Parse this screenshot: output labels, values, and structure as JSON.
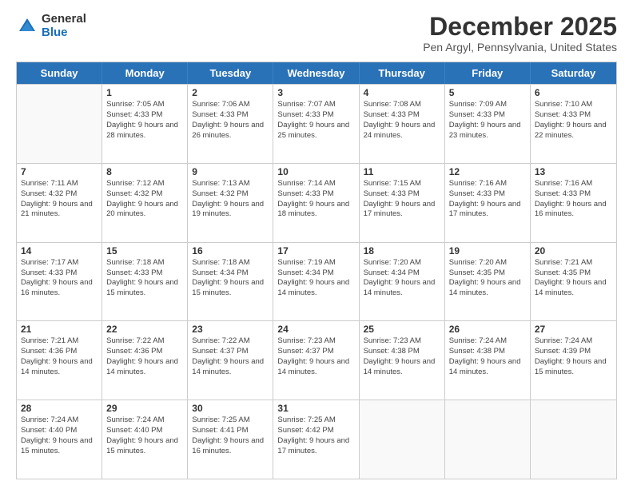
{
  "logo": {
    "general": "General",
    "blue": "Blue"
  },
  "header": {
    "month": "December 2025",
    "location": "Pen Argyl, Pennsylvania, United States"
  },
  "days": [
    "Sunday",
    "Monday",
    "Tuesday",
    "Wednesday",
    "Thursday",
    "Friday",
    "Saturday"
  ],
  "weeks": [
    [
      {
        "day": "",
        "empty": true
      },
      {
        "day": "1",
        "sunrise": "Sunrise: 7:05 AM",
        "sunset": "Sunset: 4:33 PM",
        "daylight": "Daylight: 9 hours and 28 minutes."
      },
      {
        "day": "2",
        "sunrise": "Sunrise: 7:06 AM",
        "sunset": "Sunset: 4:33 PM",
        "daylight": "Daylight: 9 hours and 26 minutes."
      },
      {
        "day": "3",
        "sunrise": "Sunrise: 7:07 AM",
        "sunset": "Sunset: 4:33 PM",
        "daylight": "Daylight: 9 hours and 25 minutes."
      },
      {
        "day": "4",
        "sunrise": "Sunrise: 7:08 AM",
        "sunset": "Sunset: 4:33 PM",
        "daylight": "Daylight: 9 hours and 24 minutes."
      },
      {
        "day": "5",
        "sunrise": "Sunrise: 7:09 AM",
        "sunset": "Sunset: 4:33 PM",
        "daylight": "Daylight: 9 hours and 23 minutes."
      },
      {
        "day": "6",
        "sunrise": "Sunrise: 7:10 AM",
        "sunset": "Sunset: 4:33 PM",
        "daylight": "Daylight: 9 hours and 22 minutes."
      }
    ],
    [
      {
        "day": "7",
        "sunrise": "Sunrise: 7:11 AM",
        "sunset": "Sunset: 4:32 PM",
        "daylight": "Daylight: 9 hours and 21 minutes."
      },
      {
        "day": "8",
        "sunrise": "Sunrise: 7:12 AM",
        "sunset": "Sunset: 4:32 PM",
        "daylight": "Daylight: 9 hours and 20 minutes."
      },
      {
        "day": "9",
        "sunrise": "Sunrise: 7:13 AM",
        "sunset": "Sunset: 4:32 PM",
        "daylight": "Daylight: 9 hours and 19 minutes."
      },
      {
        "day": "10",
        "sunrise": "Sunrise: 7:14 AM",
        "sunset": "Sunset: 4:33 PM",
        "daylight": "Daylight: 9 hours and 18 minutes."
      },
      {
        "day": "11",
        "sunrise": "Sunrise: 7:15 AM",
        "sunset": "Sunset: 4:33 PM",
        "daylight": "Daylight: 9 hours and 17 minutes."
      },
      {
        "day": "12",
        "sunrise": "Sunrise: 7:16 AM",
        "sunset": "Sunset: 4:33 PM",
        "daylight": "Daylight: 9 hours and 17 minutes."
      },
      {
        "day": "13",
        "sunrise": "Sunrise: 7:16 AM",
        "sunset": "Sunset: 4:33 PM",
        "daylight": "Daylight: 9 hours and 16 minutes."
      }
    ],
    [
      {
        "day": "14",
        "sunrise": "Sunrise: 7:17 AM",
        "sunset": "Sunset: 4:33 PM",
        "daylight": "Daylight: 9 hours and 16 minutes."
      },
      {
        "day": "15",
        "sunrise": "Sunrise: 7:18 AM",
        "sunset": "Sunset: 4:33 PM",
        "daylight": "Daylight: 9 hours and 15 minutes."
      },
      {
        "day": "16",
        "sunrise": "Sunrise: 7:18 AM",
        "sunset": "Sunset: 4:34 PM",
        "daylight": "Daylight: 9 hours and 15 minutes."
      },
      {
        "day": "17",
        "sunrise": "Sunrise: 7:19 AM",
        "sunset": "Sunset: 4:34 PM",
        "daylight": "Daylight: 9 hours and 14 minutes."
      },
      {
        "day": "18",
        "sunrise": "Sunrise: 7:20 AM",
        "sunset": "Sunset: 4:34 PM",
        "daylight": "Daylight: 9 hours and 14 minutes."
      },
      {
        "day": "19",
        "sunrise": "Sunrise: 7:20 AM",
        "sunset": "Sunset: 4:35 PM",
        "daylight": "Daylight: 9 hours and 14 minutes."
      },
      {
        "day": "20",
        "sunrise": "Sunrise: 7:21 AM",
        "sunset": "Sunset: 4:35 PM",
        "daylight": "Daylight: 9 hours and 14 minutes."
      }
    ],
    [
      {
        "day": "21",
        "sunrise": "Sunrise: 7:21 AM",
        "sunset": "Sunset: 4:36 PM",
        "daylight": "Daylight: 9 hours and 14 minutes."
      },
      {
        "day": "22",
        "sunrise": "Sunrise: 7:22 AM",
        "sunset": "Sunset: 4:36 PM",
        "daylight": "Daylight: 9 hours and 14 minutes."
      },
      {
        "day": "23",
        "sunrise": "Sunrise: 7:22 AM",
        "sunset": "Sunset: 4:37 PM",
        "daylight": "Daylight: 9 hours and 14 minutes."
      },
      {
        "day": "24",
        "sunrise": "Sunrise: 7:23 AM",
        "sunset": "Sunset: 4:37 PM",
        "daylight": "Daylight: 9 hours and 14 minutes."
      },
      {
        "day": "25",
        "sunrise": "Sunrise: 7:23 AM",
        "sunset": "Sunset: 4:38 PM",
        "daylight": "Daylight: 9 hours and 14 minutes."
      },
      {
        "day": "26",
        "sunrise": "Sunrise: 7:24 AM",
        "sunset": "Sunset: 4:38 PM",
        "daylight": "Daylight: 9 hours and 14 minutes."
      },
      {
        "day": "27",
        "sunrise": "Sunrise: 7:24 AM",
        "sunset": "Sunset: 4:39 PM",
        "daylight": "Daylight: 9 hours and 15 minutes."
      }
    ],
    [
      {
        "day": "28",
        "sunrise": "Sunrise: 7:24 AM",
        "sunset": "Sunset: 4:40 PM",
        "daylight": "Daylight: 9 hours and 15 minutes."
      },
      {
        "day": "29",
        "sunrise": "Sunrise: 7:24 AM",
        "sunset": "Sunset: 4:40 PM",
        "daylight": "Daylight: 9 hours and 15 minutes."
      },
      {
        "day": "30",
        "sunrise": "Sunrise: 7:25 AM",
        "sunset": "Sunset: 4:41 PM",
        "daylight": "Daylight: 9 hours and 16 minutes."
      },
      {
        "day": "31",
        "sunrise": "Sunrise: 7:25 AM",
        "sunset": "Sunset: 4:42 PM",
        "daylight": "Daylight: 9 hours and 17 minutes."
      },
      {
        "day": "",
        "empty": true
      },
      {
        "day": "",
        "empty": true
      },
      {
        "day": "",
        "empty": true
      }
    ]
  ]
}
